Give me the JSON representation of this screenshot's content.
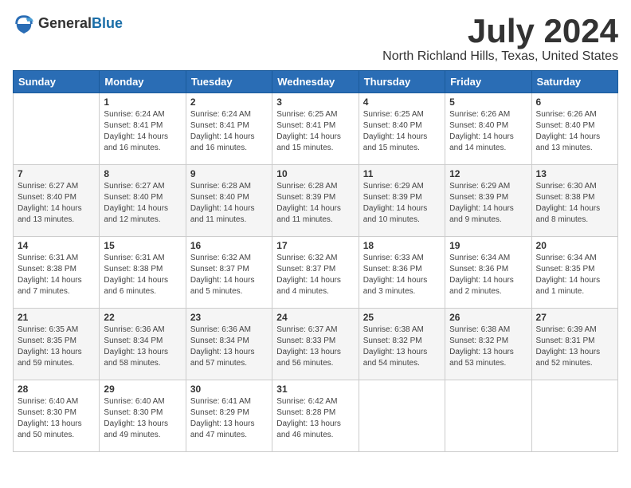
{
  "logo": {
    "text_general": "General",
    "text_blue": "Blue"
  },
  "title": "July 2024",
  "location": "North Richland Hills, Texas, United States",
  "days_of_week": [
    "Sunday",
    "Monday",
    "Tuesday",
    "Wednesday",
    "Thursday",
    "Friday",
    "Saturday"
  ],
  "weeks": [
    [
      {
        "day": "",
        "info": ""
      },
      {
        "day": "1",
        "info": "Sunrise: 6:24 AM\nSunset: 8:41 PM\nDaylight: 14 hours\nand 16 minutes."
      },
      {
        "day": "2",
        "info": "Sunrise: 6:24 AM\nSunset: 8:41 PM\nDaylight: 14 hours\nand 16 minutes."
      },
      {
        "day": "3",
        "info": "Sunrise: 6:25 AM\nSunset: 8:41 PM\nDaylight: 14 hours\nand 15 minutes."
      },
      {
        "day": "4",
        "info": "Sunrise: 6:25 AM\nSunset: 8:40 PM\nDaylight: 14 hours\nand 15 minutes."
      },
      {
        "day": "5",
        "info": "Sunrise: 6:26 AM\nSunset: 8:40 PM\nDaylight: 14 hours\nand 14 minutes."
      },
      {
        "day": "6",
        "info": "Sunrise: 6:26 AM\nSunset: 8:40 PM\nDaylight: 14 hours\nand 13 minutes."
      }
    ],
    [
      {
        "day": "7",
        "info": "Sunrise: 6:27 AM\nSunset: 8:40 PM\nDaylight: 14 hours\nand 13 minutes."
      },
      {
        "day": "8",
        "info": "Sunrise: 6:27 AM\nSunset: 8:40 PM\nDaylight: 14 hours\nand 12 minutes."
      },
      {
        "day": "9",
        "info": "Sunrise: 6:28 AM\nSunset: 8:40 PM\nDaylight: 14 hours\nand 11 minutes."
      },
      {
        "day": "10",
        "info": "Sunrise: 6:28 AM\nSunset: 8:39 PM\nDaylight: 14 hours\nand 11 minutes."
      },
      {
        "day": "11",
        "info": "Sunrise: 6:29 AM\nSunset: 8:39 PM\nDaylight: 14 hours\nand 10 minutes."
      },
      {
        "day": "12",
        "info": "Sunrise: 6:29 AM\nSunset: 8:39 PM\nDaylight: 14 hours\nand 9 minutes."
      },
      {
        "day": "13",
        "info": "Sunrise: 6:30 AM\nSunset: 8:38 PM\nDaylight: 14 hours\nand 8 minutes."
      }
    ],
    [
      {
        "day": "14",
        "info": "Sunrise: 6:31 AM\nSunset: 8:38 PM\nDaylight: 14 hours\nand 7 minutes."
      },
      {
        "day": "15",
        "info": "Sunrise: 6:31 AM\nSunset: 8:38 PM\nDaylight: 14 hours\nand 6 minutes."
      },
      {
        "day": "16",
        "info": "Sunrise: 6:32 AM\nSunset: 8:37 PM\nDaylight: 14 hours\nand 5 minutes."
      },
      {
        "day": "17",
        "info": "Sunrise: 6:32 AM\nSunset: 8:37 PM\nDaylight: 14 hours\nand 4 minutes."
      },
      {
        "day": "18",
        "info": "Sunrise: 6:33 AM\nSunset: 8:36 PM\nDaylight: 14 hours\nand 3 minutes."
      },
      {
        "day": "19",
        "info": "Sunrise: 6:34 AM\nSunset: 8:36 PM\nDaylight: 14 hours\nand 2 minutes."
      },
      {
        "day": "20",
        "info": "Sunrise: 6:34 AM\nSunset: 8:35 PM\nDaylight: 14 hours\nand 1 minute."
      }
    ],
    [
      {
        "day": "21",
        "info": "Sunrise: 6:35 AM\nSunset: 8:35 PM\nDaylight: 13 hours\nand 59 minutes."
      },
      {
        "day": "22",
        "info": "Sunrise: 6:36 AM\nSunset: 8:34 PM\nDaylight: 13 hours\nand 58 minutes."
      },
      {
        "day": "23",
        "info": "Sunrise: 6:36 AM\nSunset: 8:34 PM\nDaylight: 13 hours\nand 57 minutes."
      },
      {
        "day": "24",
        "info": "Sunrise: 6:37 AM\nSunset: 8:33 PM\nDaylight: 13 hours\nand 56 minutes."
      },
      {
        "day": "25",
        "info": "Sunrise: 6:38 AM\nSunset: 8:32 PM\nDaylight: 13 hours\nand 54 minutes."
      },
      {
        "day": "26",
        "info": "Sunrise: 6:38 AM\nSunset: 8:32 PM\nDaylight: 13 hours\nand 53 minutes."
      },
      {
        "day": "27",
        "info": "Sunrise: 6:39 AM\nSunset: 8:31 PM\nDaylight: 13 hours\nand 52 minutes."
      }
    ],
    [
      {
        "day": "28",
        "info": "Sunrise: 6:40 AM\nSunset: 8:30 PM\nDaylight: 13 hours\nand 50 minutes."
      },
      {
        "day": "29",
        "info": "Sunrise: 6:40 AM\nSunset: 8:30 PM\nDaylight: 13 hours\nand 49 minutes."
      },
      {
        "day": "30",
        "info": "Sunrise: 6:41 AM\nSunset: 8:29 PM\nDaylight: 13 hours\nand 47 minutes."
      },
      {
        "day": "31",
        "info": "Sunrise: 6:42 AM\nSunset: 8:28 PM\nDaylight: 13 hours\nand 46 minutes."
      },
      {
        "day": "",
        "info": ""
      },
      {
        "day": "",
        "info": ""
      },
      {
        "day": "",
        "info": ""
      }
    ]
  ]
}
